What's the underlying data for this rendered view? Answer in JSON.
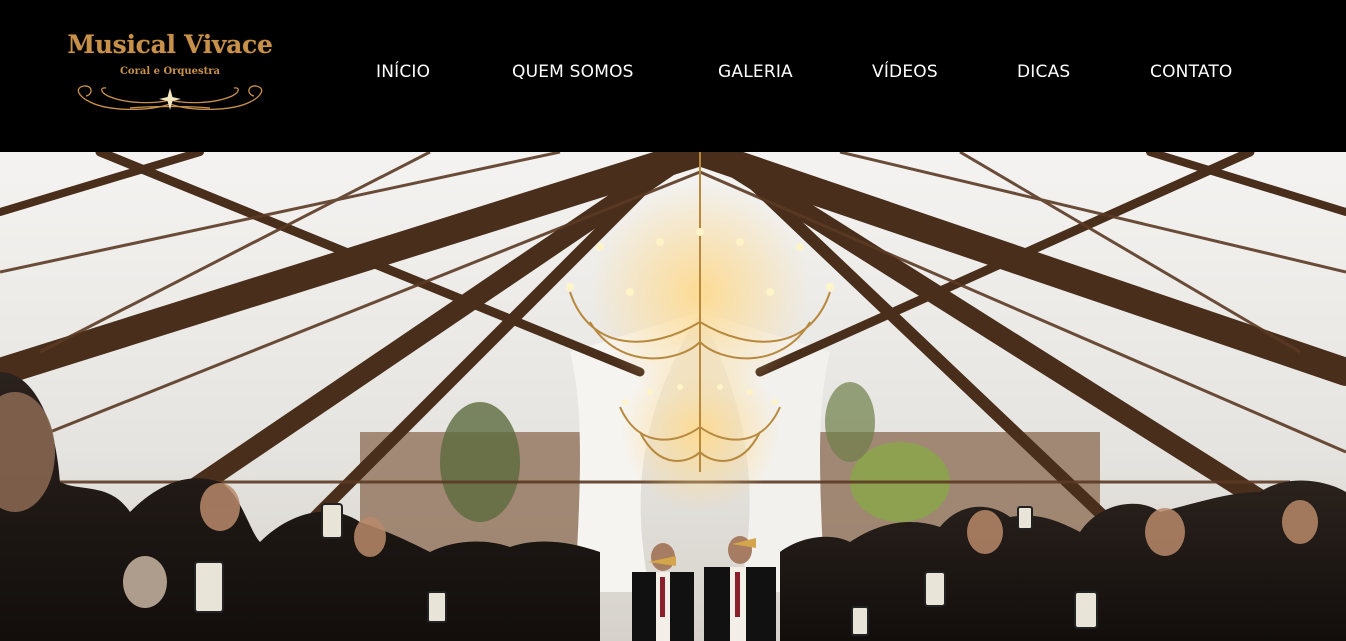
{
  "logo": {
    "title": "Musical Vivace",
    "subtitle": "Coral e Orquestra"
  },
  "nav": {
    "items": [
      {
        "label": "INÍCIO"
      },
      {
        "label": "QUEM SOMOS"
      },
      {
        "label": "GALERIA"
      },
      {
        "label": "VÍDEOS"
      },
      {
        "label": "DICAS"
      },
      {
        "label": "CONTATO"
      }
    ]
  },
  "colors": {
    "header_bg": "#000000",
    "nav_text": "#ffffff",
    "logo_gold": "#c8914a"
  }
}
